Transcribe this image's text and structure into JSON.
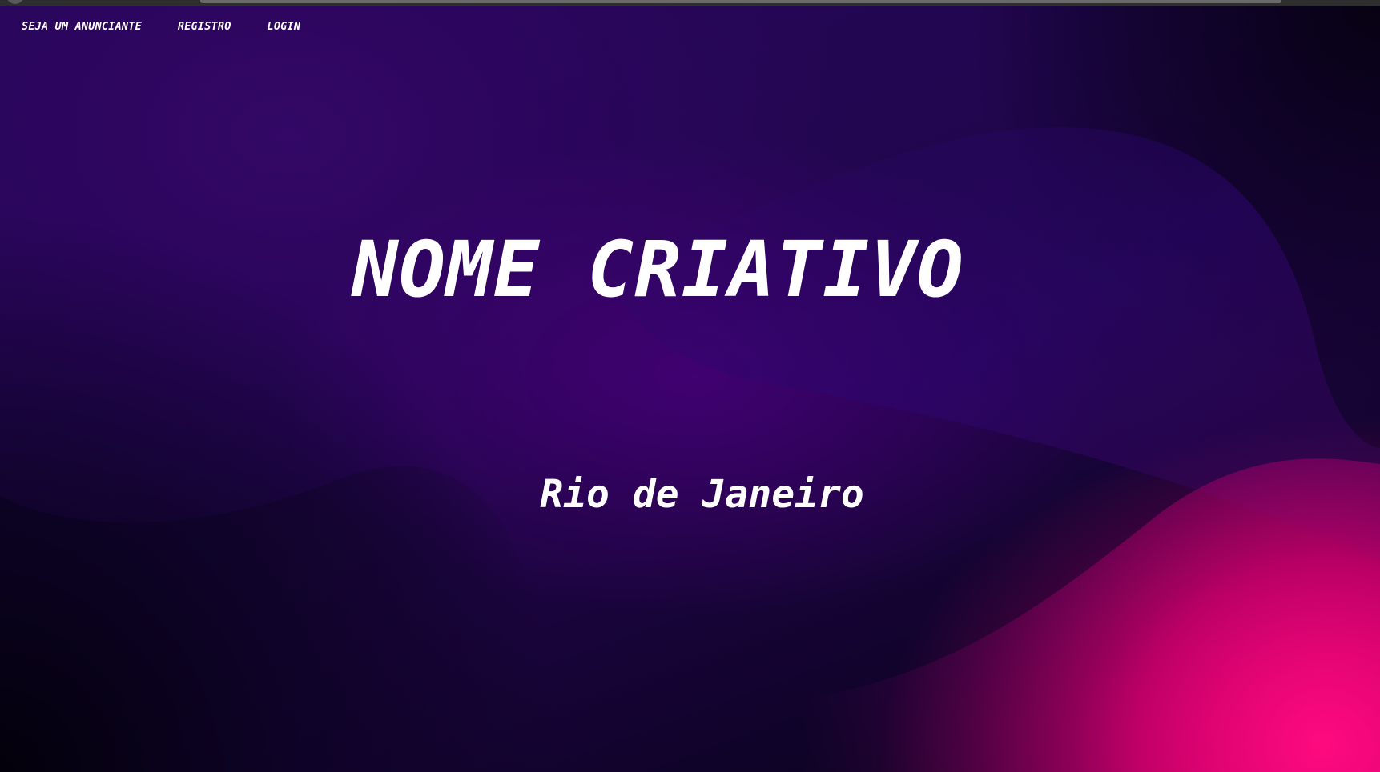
{
  "nav": {
    "items": [
      {
        "label": "SEJA UM ANUNCIANTE"
      },
      {
        "label": "REGISTRO"
      },
      {
        "label": "LOGIN"
      }
    ]
  },
  "hero": {
    "title": "NOME CRIATIVO",
    "subtitle": "Rio de Janeiro"
  },
  "colors": {
    "text": "#ffffff",
    "background_dark": "#070214",
    "background_purple": "#2a0760",
    "accent_pink": "#ff0a7e"
  }
}
